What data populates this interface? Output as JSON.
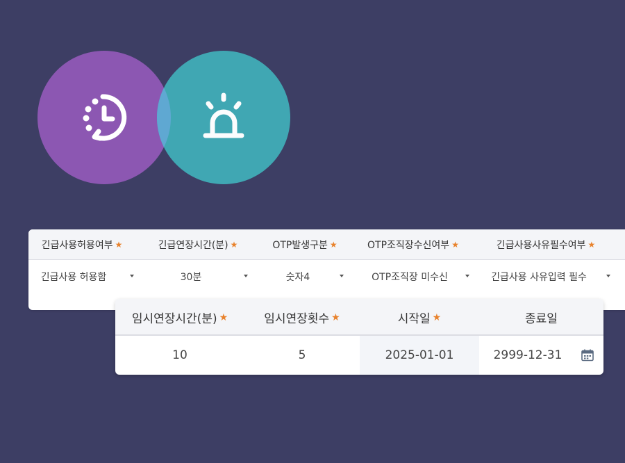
{
  "icons": {
    "history": "history-clock-icon",
    "alarm": "siren-alarm-icon"
  },
  "colors": {
    "background": "#3d3e64",
    "purple": "#8c57b2",
    "teal": "#41a9b4",
    "star": "#e8822c"
  },
  "back_table": {
    "headers": [
      "긴급사용허용여부",
      "긴급연장시간(분)",
      "OTP발생구분",
      "OTP조직장수신여부",
      "긴급사용사유필수여부"
    ],
    "values": [
      "긴급사용 허용함",
      "30분",
      "숫자4",
      "OTP조직장 미수신",
      "긴급사용 사유입력 필수"
    ]
  },
  "front_table": {
    "headers": [
      "임시연장시간(분)",
      "임시연장횟수",
      "시작일",
      "종료일"
    ],
    "values": [
      "10",
      "5",
      "2025-01-01",
      "2999-12-31"
    ]
  },
  "star_symbol": "★"
}
